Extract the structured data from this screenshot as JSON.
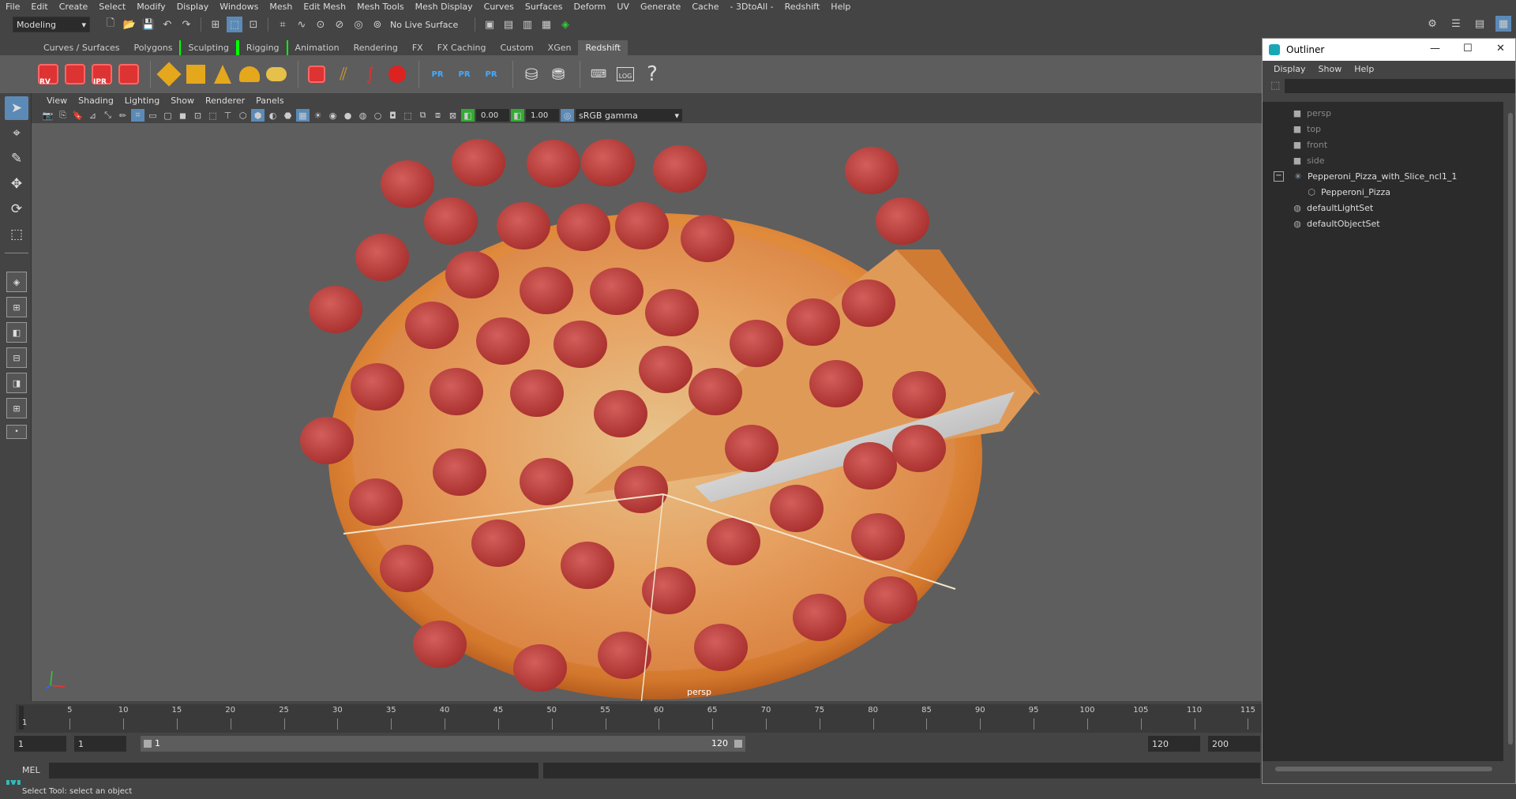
{
  "menubar": {
    "items": [
      "File",
      "Edit",
      "Create",
      "Select",
      "Modify",
      "Display",
      "Windows",
      "Mesh",
      "Edit Mesh",
      "Mesh Tools",
      "Mesh Display",
      "Curves",
      "Surfaces",
      "Deform",
      "UV",
      "Generate",
      "Cache",
      "- 3DtoAll -",
      "Redshift",
      "Help"
    ]
  },
  "statusline": {
    "mode": "Modeling",
    "live_surface": "No Live Surface"
  },
  "shelf_tabs": [
    "Curves / Surfaces",
    "Polygons",
    "Sculpting",
    "Rigging",
    "Animation",
    "Rendering",
    "FX",
    "FX Caching",
    "Custom",
    "XGen",
    "Redshift"
  ],
  "shelf": {
    "rv_label": "RV",
    "ipr_label": "IPR",
    "pr_label": "PR",
    "log_label": "LOG",
    "help_label": "?"
  },
  "panel": {
    "menu": [
      "View",
      "Shading",
      "Lighting",
      "Show",
      "Renderer",
      "Panels"
    ],
    "exposure": "0.00",
    "gamma_value": "1.00",
    "color_space": "sRGB gamma",
    "camera_label": "persp"
  },
  "outliner": {
    "title": "Outliner",
    "menu": [
      "Display",
      "Show",
      "Help"
    ],
    "items": [
      {
        "label": "persp",
        "icon": "camera-icon",
        "dim": true
      },
      {
        "label": "top",
        "icon": "camera-icon",
        "dim": true
      },
      {
        "label": "front",
        "icon": "camera-icon",
        "dim": true
      },
      {
        "label": "side",
        "icon": "camera-icon",
        "dim": true
      },
      {
        "label": "Pepperoni_Pizza_with_Slice_ncl1_1",
        "icon": "group-icon",
        "dim": false
      },
      {
        "label": "Pepperoni_Pizza",
        "icon": "mesh-icon",
        "dim": false
      },
      {
        "label": "defaultLightSet",
        "icon": "set-icon",
        "dim": false
      },
      {
        "label": "defaultObjectSet",
        "icon": "set-icon",
        "dim": false
      }
    ]
  },
  "timeline": {
    "ticks": [
      "5",
      "10",
      "15",
      "20",
      "25",
      "30",
      "35",
      "40",
      "45",
      "50",
      "55",
      "60",
      "65",
      "70",
      "75",
      "80",
      "85",
      "90",
      "95",
      "100",
      "105",
      "110",
      "115"
    ],
    "current_frame": "1"
  },
  "range": {
    "start_frame": "1",
    "playback_start": "1",
    "range_start": "1",
    "range_end": "120",
    "playback_end": "120",
    "end_frame": "200"
  },
  "cmdline": {
    "label": "MEL"
  },
  "helpline": {
    "text": "Select Tool: select an object"
  },
  "colors": {
    "accent": "#5b8ab7",
    "redshift": "#dd3333",
    "viewport_bg": "#5e5e5e"
  }
}
